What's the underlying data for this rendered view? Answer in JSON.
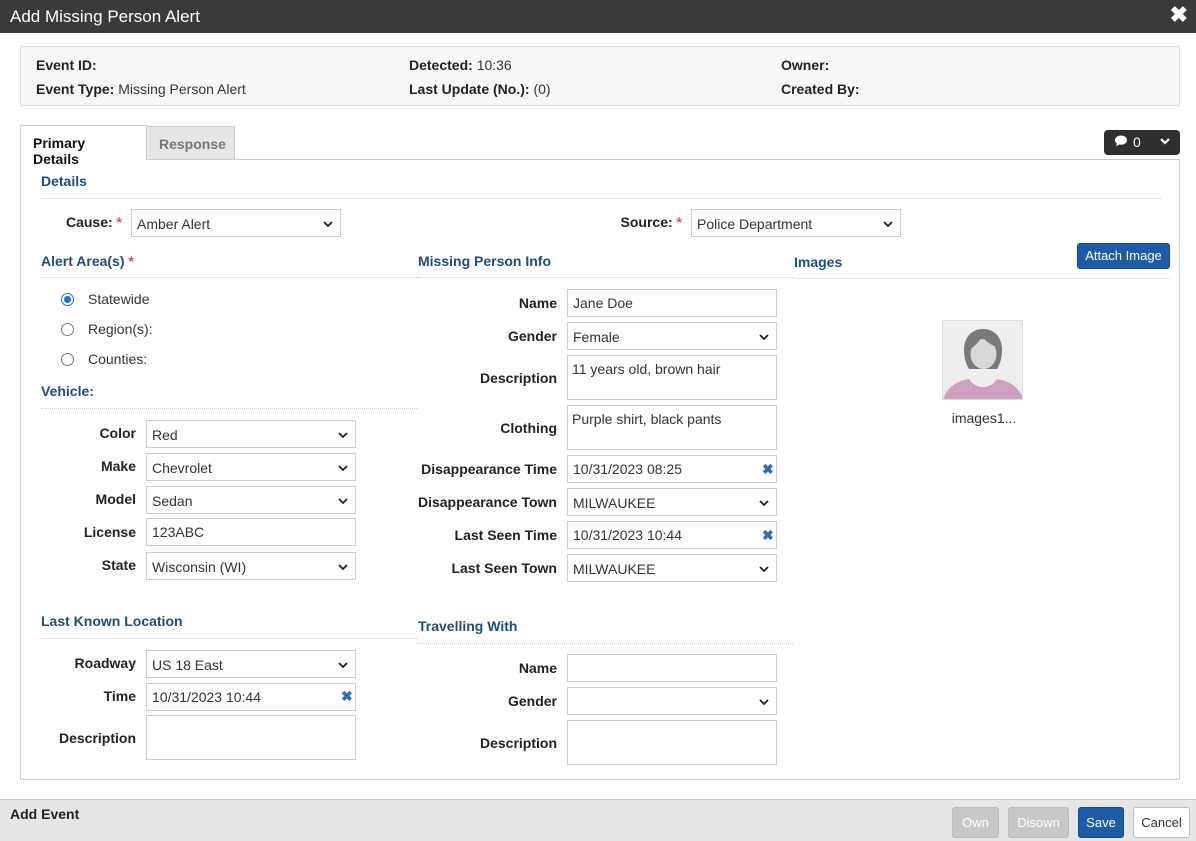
{
  "window": {
    "title": "Add Missing Person Alert"
  },
  "info": {
    "event_id_label": "Event ID:",
    "event_id_value": "",
    "event_type_label": "Event Type:",
    "event_type_value": "Missing Person Alert",
    "detected_label": "Detected:",
    "detected_value": "10:36",
    "last_update_label": "Last Update (No.):",
    "last_update_value": "(0)",
    "owner_label": "Owner:",
    "owner_value": "",
    "created_by_label": "Created By:",
    "created_by_value": ""
  },
  "tabs": [
    {
      "label": "Primary Details",
      "active": true
    },
    {
      "label": "Response",
      "active": false
    }
  ],
  "comments": {
    "count": "0"
  },
  "details": {
    "heading": "Details",
    "cause_label": "Cause:",
    "cause_value": "Amber Alert",
    "source_label": "Source:",
    "source_value": "Police Department"
  },
  "alert_area": {
    "heading": "Alert Area(s)",
    "options": [
      "Statewide",
      "Region(s):",
      "Counties:"
    ],
    "selected": "Statewide"
  },
  "vehicle": {
    "heading": "Vehicle:",
    "color_label": "Color",
    "color_value": "Red",
    "make_label": "Make",
    "make_value": "Chevrolet",
    "model_label": "Model",
    "model_value": "Sedan",
    "license_label": "License",
    "license_value": "123ABC",
    "state_label": "State",
    "state_value": "Wisconsin (WI)"
  },
  "last_known": {
    "heading": "Last Known Location",
    "roadway_label": "Roadway",
    "roadway_value": "US 18 East",
    "time_label": "Time",
    "time_value": "10/31/2023 10:44",
    "description_label": "Description",
    "description_value": ""
  },
  "missing_person": {
    "heading": "Missing Person Info",
    "name_label": "Name",
    "name_value": "Jane Doe",
    "gender_label": "Gender",
    "gender_value": "Female",
    "description_label": "Description",
    "description_value": "11 years old, brown hair",
    "clothing_label": "Clothing",
    "clothing_value": "Purple shirt, black pants",
    "disappearance_time_label": "Disappearance Time",
    "disappearance_time_value": "10/31/2023 08:25",
    "disappearance_town_label": "Disappearance Town",
    "disappearance_town_value": "MILWAUKEE",
    "last_seen_time_label": "Last Seen Time",
    "last_seen_time_value": "10/31/2023 10:44",
    "last_seen_town_label": "Last Seen Town",
    "last_seen_town_value": "MILWAUKEE"
  },
  "travelling_with": {
    "heading": "Travelling With",
    "name_label": "Name",
    "name_value": "",
    "gender_label": "Gender",
    "gender_value": "",
    "description_label": "Description",
    "description_value": ""
  },
  "images": {
    "heading": "Images",
    "attach_label": "Attach Image",
    "items": [
      {
        "label": "images1..."
      }
    ]
  },
  "footer": {
    "title": "Add Event",
    "own_label": "Own",
    "disown_label": "Disown",
    "save_label": "Save",
    "cancel_label": "Cancel"
  }
}
